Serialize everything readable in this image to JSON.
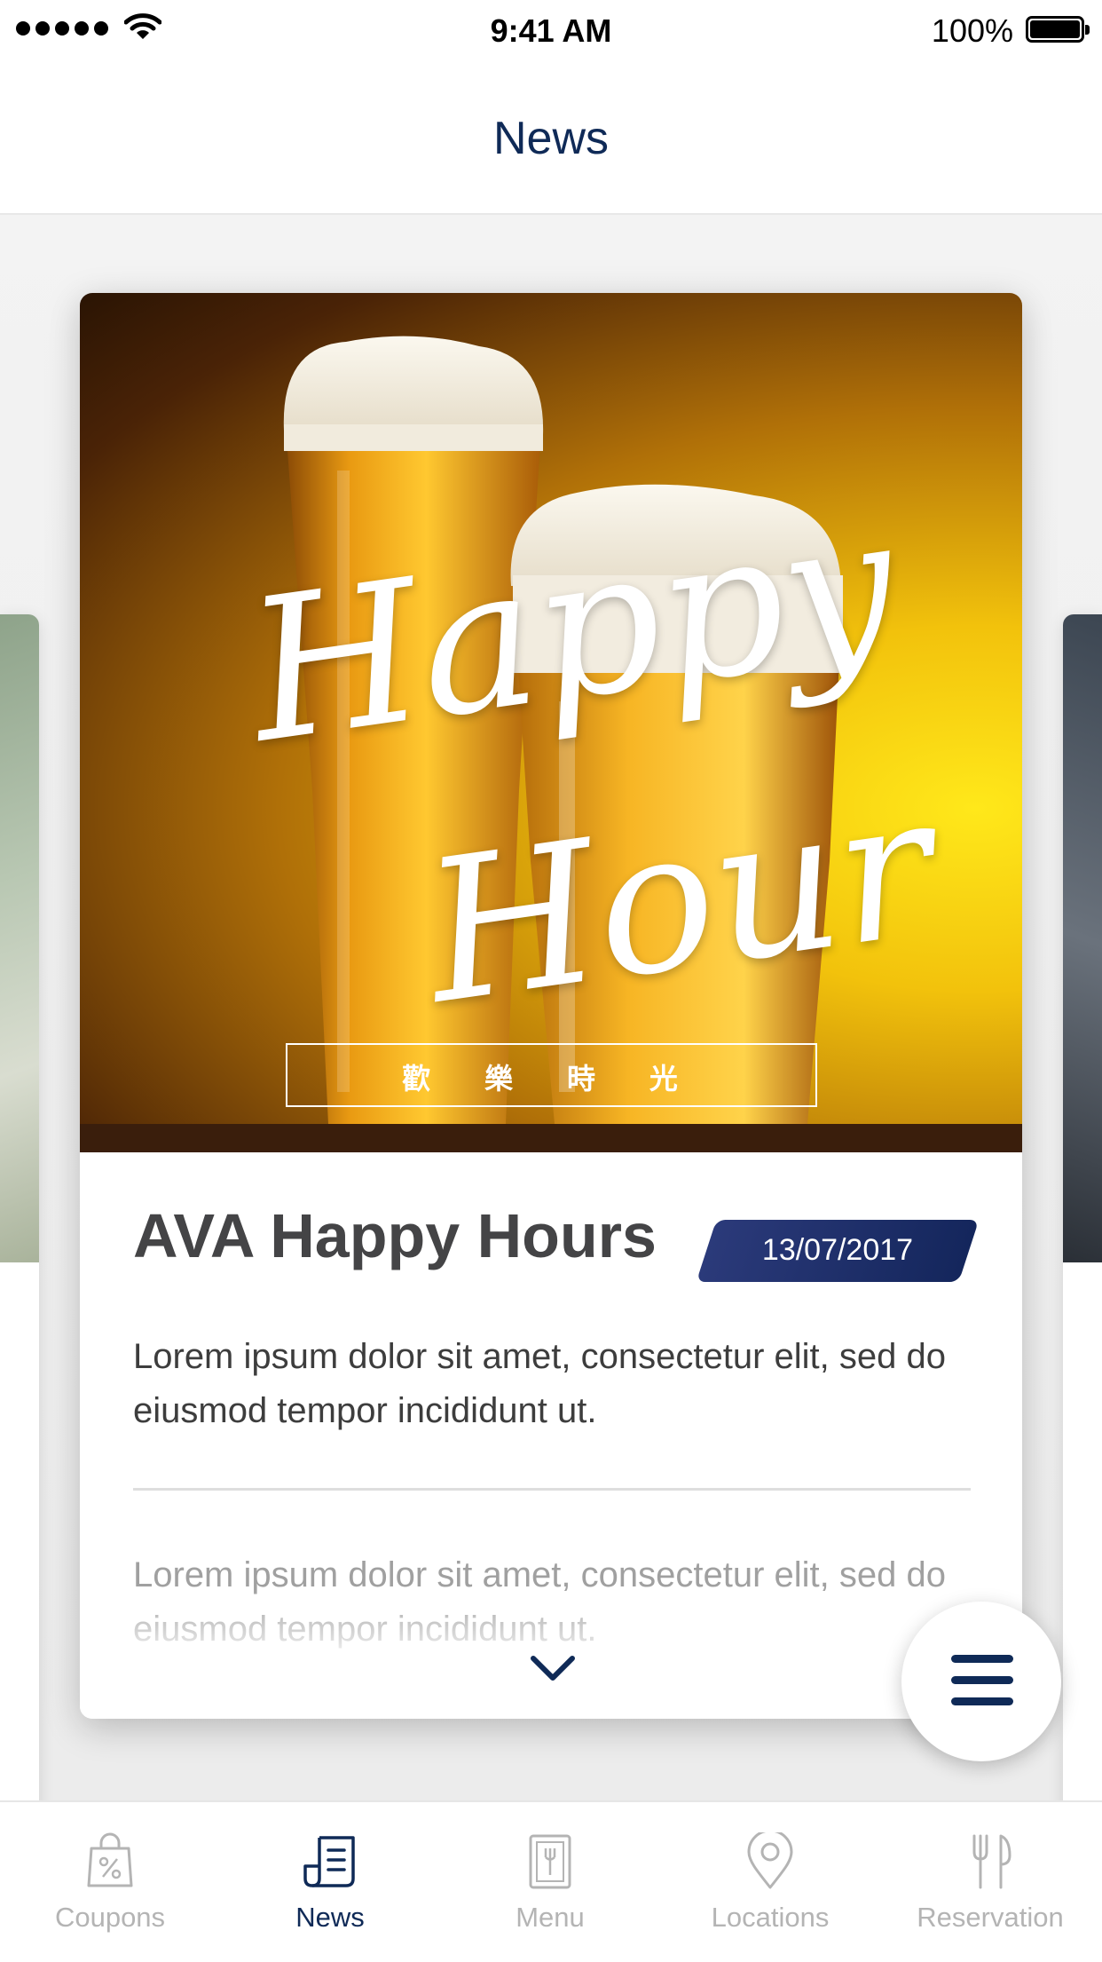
{
  "status_bar": {
    "time": "9:41 AM",
    "battery": "100%"
  },
  "header": {
    "title": "News"
  },
  "card": {
    "image_text": {
      "script_line1": "Happy",
      "script_line2": "Hour",
      "chinese_caption": "歡 樂 時 光"
    },
    "title": "AVA Happy Hours",
    "date": "13/07/2017",
    "paragraph1": "Lorem ipsum dolor sit amet, consectetur elit, sed do eiusmod tempor incididunt ut.",
    "paragraph2": "Lorem ipsum dolor sit amet, consectetur elit, sed do eiusmod tempor incididunt ut."
  },
  "tabs": [
    {
      "label": "Coupons",
      "icon": "coupon-bag-icon",
      "active": false
    },
    {
      "label": "News",
      "icon": "news-icon",
      "active": true
    },
    {
      "label": "Menu",
      "icon": "menu-book-icon",
      "active": false
    },
    {
      "label": "Locations",
      "icon": "location-pin-icon",
      "active": false
    },
    {
      "label": "Reservation",
      "icon": "fork-knife-icon",
      "active": false
    }
  ],
  "colors": {
    "primary": "#0f2a57",
    "text_dark": "#444446",
    "text_muted": "#b4b4b4",
    "badge": "#1e2f6a"
  }
}
